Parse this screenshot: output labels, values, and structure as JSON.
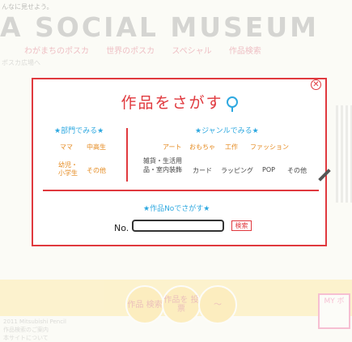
{
  "background": {
    "top_text": "んなに見せよう。",
    "logo": "A SOCIAL MUSEUM",
    "nav": [
      "わがまちのポスカ",
      "世界のポスカ",
      "スペシャル",
      "作品検索"
    ],
    "small_text": "ポスカ広場へ",
    "circles": [
      "作品\n検索",
      "作品を\n投票",
      "〜"
    ],
    "right_box": "MY\nボ",
    "footer": [
      "2011 Mitsubishi Pencil",
      "作品検索のご案内",
      "本サイトについて"
    ]
  },
  "modal": {
    "title": "作品をさがす",
    "close_symbol": "✕",
    "category_heading": "★部門でみる★",
    "categories": [
      "ママ",
      "中高生",
      "幼児・小学生",
      "その他"
    ],
    "genre_heading": "★ジャンルでみる★",
    "genres_row1": [
      "アート",
      "おもちゃ",
      "工作",
      "ファッション"
    ],
    "genres_row2": [
      "雑貨・生活用品・室内装飾",
      "カード",
      "ラッピング",
      "POP",
      "その他"
    ],
    "number_heading": "★作品Noでさがす★",
    "number_label": "No.",
    "number_value": "",
    "search_button": "検索"
  },
  "colors": {
    "accent_red": "#e0393e",
    "accent_blue": "#2da8e0",
    "accent_orange": "#e58a1f"
  }
}
